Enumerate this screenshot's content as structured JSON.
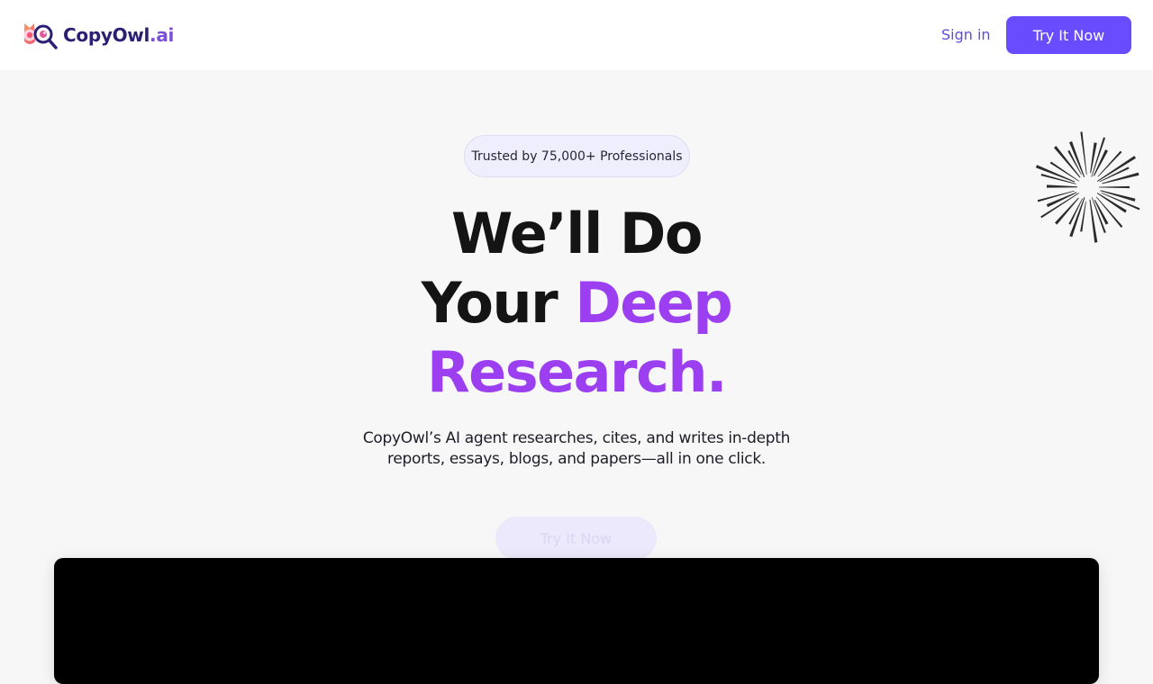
{
  "header": {
    "logo_name": "CopyOwl",
    "logo_tld": ".ai",
    "sign_in_label": "Sign in",
    "cta_label": "Try It Now"
  },
  "badge": {
    "text": "Trusted by 75,000+ Professionals"
  },
  "hero": {
    "headline_line1": "We’ll Do",
    "headline_line2_plain": "Your ",
    "headline_line2_accent": "Deep",
    "headline_line3_accent": "Research.",
    "subhead": "CopyOwl’s AI agent researches, cites, and writes in-depth reports, essays, blogs, and papers—all in one click.",
    "cta_label": "Try It Now"
  },
  "icons": {
    "logo": "owl-magnifier-logo-icon",
    "decoration": "starburst-icon"
  },
  "colors": {
    "brand_primary": "#6a4cff",
    "accent_purple": "#9b3ff0",
    "logo_dark": "#2a1f72",
    "page_background": "#f7f7f8"
  }
}
